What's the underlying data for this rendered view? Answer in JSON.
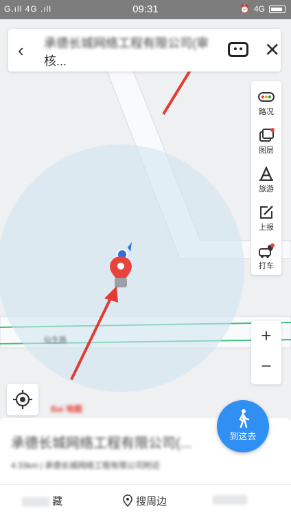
{
  "status_bar": {
    "left": "G.ıll 4G .ıll",
    "time": "09:31",
    "right": "4G"
  },
  "search": {
    "query_line1": "承德长城网络工程有限公司(审",
    "query_line2": "核..."
  },
  "side_panel": {
    "items": [
      {
        "label": "路况"
      },
      {
        "label": "图层"
      },
      {
        "label": "旅游"
      },
      {
        "label": "上报"
      },
      {
        "label": "打车"
      }
    ]
  },
  "map": {
    "road_label": "仙生路",
    "logo_text": "Bai 地图"
  },
  "sheet": {
    "title": "承德长城网络工程有限公司(...",
    "subtitle": "4.33km | 承德长城网络工程有限公司附近",
    "action_save": "藏",
    "action_nearby": "搜周边"
  },
  "go_button": {
    "label": "到这去"
  },
  "colors": {
    "accent": "#2f8ff2",
    "pin": "#e8443b",
    "arrow": "#e23b33",
    "route_line": "#40c080"
  }
}
